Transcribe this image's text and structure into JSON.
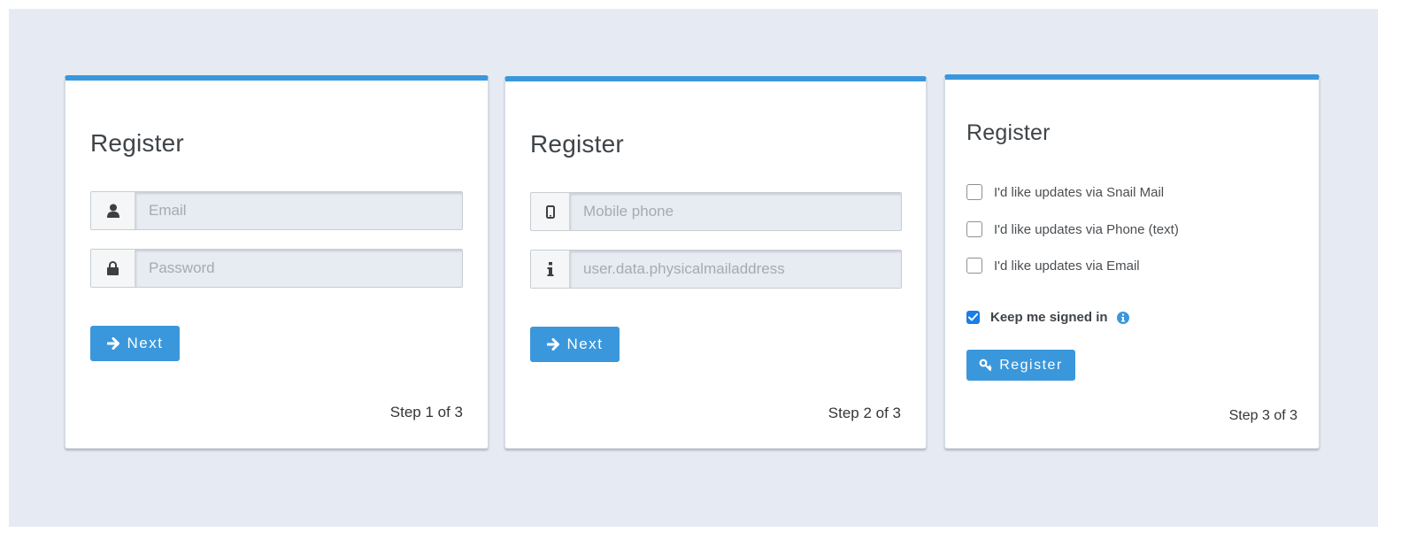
{
  "colors": {
    "accent": "#3a97dc",
    "background": "#e6ebf3",
    "checkbox_checked": "#1a7ee6"
  },
  "cards": [
    {
      "title": "Register",
      "fields": [
        {
          "icon": "user-icon",
          "placeholder": "Email",
          "value": ""
        },
        {
          "icon": "lock-icon",
          "placeholder": "Password",
          "value": ""
        }
      ],
      "button": {
        "icon": "arrow-right-icon",
        "label": "Next"
      },
      "step": "Step 1 of 3"
    },
    {
      "title": "Register",
      "fields": [
        {
          "icon": "mobile-phone-icon",
          "placeholder": "Mobile phone",
          "value": ""
        },
        {
          "icon": "info-icon",
          "placeholder": "user.data.physicalmailaddress",
          "value": ""
        }
      ],
      "button": {
        "icon": "arrow-right-icon",
        "label": "Next"
      },
      "step": "Step 2 of 3"
    },
    {
      "title": "Register",
      "checkboxes": [
        {
          "label": "I'd like updates via Snail Mail",
          "checked": false
        },
        {
          "label": "I'd like updates via Phone (text)",
          "checked": false
        },
        {
          "label": "I'd like updates via Email",
          "checked": false
        }
      ],
      "keep_signed_in": {
        "label": "Keep me signed in",
        "checked": true,
        "icon": "info-circle-icon"
      },
      "button": {
        "icon": "key-icon",
        "label": "Register"
      },
      "step": "Step 3 of 3"
    }
  ]
}
